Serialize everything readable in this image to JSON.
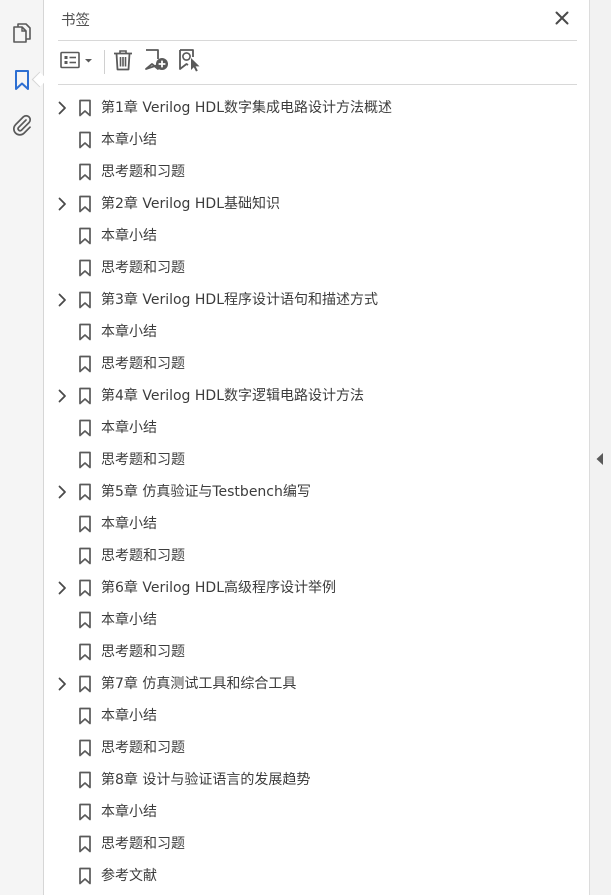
{
  "left_rail": {
    "items": [
      {
        "icon": "copy-pages-icon"
      },
      {
        "icon": "bookmark-icon",
        "active": true
      },
      {
        "icon": "paperclip-icon"
      }
    ]
  },
  "panel": {
    "title": "书签",
    "toolbar": {
      "options": "options-menu-icon",
      "delete": "trash-icon",
      "new_bookmark": "new-bookmark-icon",
      "find_bookmark": "find-bookmark-icon"
    }
  },
  "bookmarks": [
    {
      "label": "第1章 Verilog HDL数字集成电路设计方法概述",
      "expandable": true
    },
    {
      "label": "本章小结",
      "expandable": false
    },
    {
      "label": "思考题和习题",
      "expandable": false
    },
    {
      "label": "第2章 Verilog HDL基础知识",
      "expandable": true
    },
    {
      "label": "本章小结",
      "expandable": false
    },
    {
      "label": "思考题和习题",
      "expandable": false
    },
    {
      "label": "第3章 Verilog HDL程序设计语句和描述方式",
      "expandable": true
    },
    {
      "label": "本章小结",
      "expandable": false
    },
    {
      "label": "思考题和习题",
      "expandable": false
    },
    {
      "label": "第4章 Verilog HDL数字逻辑电路设计方法",
      "expandable": true
    },
    {
      "label": "本章小结",
      "expandable": false
    },
    {
      "label": "思考题和习题",
      "expandable": false
    },
    {
      "label": "第5章 仿真验证与Testbench编写",
      "expandable": true
    },
    {
      "label": "本章小结",
      "expandable": false
    },
    {
      "label": "思考题和习题",
      "expandable": false
    },
    {
      "label": "第6章 Verilog HDL高级程序设计举例",
      "expandable": true
    },
    {
      "label": "本章小结",
      "expandable": false
    },
    {
      "label": "思考题和习题",
      "expandable": false
    },
    {
      "label": "第7章 仿真测试工具和综合工具",
      "expandable": true
    },
    {
      "label": "本章小结",
      "expandable": false
    },
    {
      "label": "思考题和习题",
      "expandable": false
    },
    {
      "label": "第8章 设计与验证语言的发展趋势",
      "expandable": false
    },
    {
      "label": "本章小结",
      "expandable": false
    },
    {
      "label": "思考题和习题",
      "expandable": false
    },
    {
      "label": "参考文献",
      "expandable": false
    }
  ],
  "colors": {
    "accent": "#2d6fd2",
    "icon": "#5a5a5a"
  }
}
